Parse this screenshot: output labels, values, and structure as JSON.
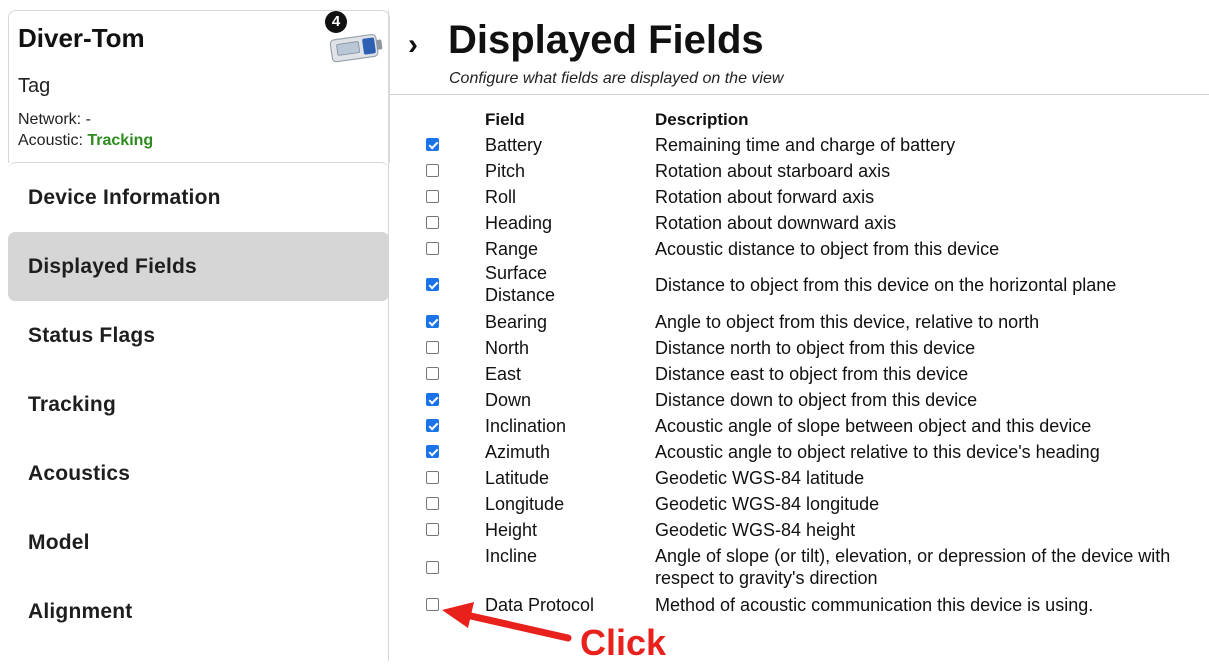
{
  "device": {
    "name": "Diver-Tom",
    "type": "Tag",
    "network_label": "Network: -",
    "acoustic_label": "Acoustic:",
    "acoustic_status": "Tracking",
    "badge_count": "4",
    "image_icon": "device-image-icon"
  },
  "nav": {
    "items": [
      {
        "label": "Device Information"
      },
      {
        "label": "Displayed Fields"
      },
      {
        "label": "Status Flags"
      },
      {
        "label": "Tracking"
      },
      {
        "label": "Acoustics"
      },
      {
        "label": "Model"
      },
      {
        "label": "Alignment"
      }
    ],
    "active": "Displayed Fields"
  },
  "main": {
    "chevron": "›",
    "title": "Displayed Fields",
    "subtitle": "Configure what fields are displayed on the view",
    "col_field": "Field",
    "col_desc": "Description",
    "rows": [
      {
        "checked": true,
        "field": "Battery",
        "desc": "Remaining time and charge of battery"
      },
      {
        "checked": false,
        "field": "Pitch",
        "desc": "Rotation about starboard axis"
      },
      {
        "checked": false,
        "field": "Roll",
        "desc": "Rotation about forward axis"
      },
      {
        "checked": false,
        "field": "Heading",
        "desc": "Rotation about downward axis"
      },
      {
        "checked": false,
        "field": "Range",
        "desc": "Acoustic distance to object from this device"
      },
      {
        "checked": true,
        "field": "Surface\nDistance",
        "desc": "Distance to object from this device on the horizontal plane"
      },
      {
        "checked": true,
        "field": "Bearing",
        "desc": "Angle to object from this device, relative to north"
      },
      {
        "checked": false,
        "field": "North",
        "desc": "Distance north to object from this device"
      },
      {
        "checked": false,
        "field": "East",
        "desc": "Distance east to object from this device"
      },
      {
        "checked": true,
        "field": "Down",
        "desc": "Distance down to object from this device"
      },
      {
        "checked": true,
        "field": "Inclination",
        "desc": "Acoustic angle of slope between object and this device"
      },
      {
        "checked": true,
        "field": "Azimuth",
        "desc": "Acoustic angle to object relative to this device's heading"
      },
      {
        "checked": false,
        "field": "Latitude",
        "desc": "Geodetic WGS-84 latitude"
      },
      {
        "checked": false,
        "field": "Longitude",
        "desc": "Geodetic WGS-84 longitude"
      },
      {
        "checked": false,
        "field": "Height",
        "desc": "Geodetic WGS-84 height"
      },
      {
        "checked": false,
        "field": "Incline",
        "desc": "Angle of slope (or tilt), elevation, or depression of the device with\nrespect to gravity's direction"
      },
      {
        "checked": false,
        "field": "Data Protocol",
        "desc": "Method of acoustic communication this device is using."
      }
    ]
  },
  "annotation": {
    "text": "Click",
    "color": "#e8211c"
  },
  "colors": {
    "accent_check": "#1a73e8",
    "tracking_green": "#2e8b1e",
    "active_nav_bg": "#d6d6d6"
  }
}
